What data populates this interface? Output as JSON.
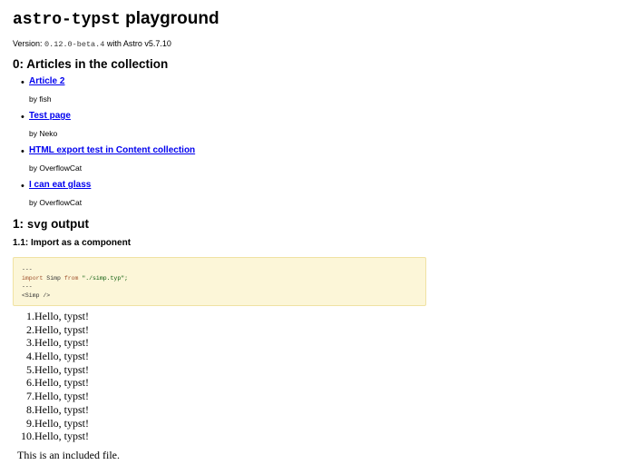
{
  "title": {
    "code": "astro-typst",
    "rest": "playground"
  },
  "version": {
    "prefix": "Version:",
    "number": "0.12.0-beta.4",
    "suffix": "with Astro v5.7.10"
  },
  "section0": {
    "heading": "0: Articles in the collection"
  },
  "articles": [
    {
      "title": "Article 2",
      "author": "by fish"
    },
    {
      "title": "Test page",
      "author": "by Neko"
    },
    {
      "title": "HTML export test in Content collection",
      "author": "by OverflowCat"
    },
    {
      "title": "I can eat glass",
      "author": "by OverflowCat"
    }
  ],
  "section1": {
    "prefix": "1:",
    "code": "svg",
    "suffix": "output"
  },
  "subsection": {
    "heading": "1.1: Import as a component"
  },
  "code": {
    "fence_open": "---",
    "import_kw": "import",
    "import_name": " Simp ",
    "from_kw": "from",
    "path": " \"./simp.typ\";",
    "fence_close": "---",
    "component": "<Simp />"
  },
  "hello_list": [
    {
      "num": "1.",
      "text": "Hello, typst!"
    },
    {
      "num": "2.",
      "text": "Hello, typst!"
    },
    {
      "num": "3.",
      "text": "Hello, typst!"
    },
    {
      "num": "4.",
      "text": "Hello, typst!"
    },
    {
      "num": "5.",
      "text": "Hello, typst!"
    },
    {
      "num": "6.",
      "text": "Hello, typst!"
    },
    {
      "num": "7.",
      "text": "Hello, typst!"
    },
    {
      "num": "8.",
      "text": "Hello, typst!"
    },
    {
      "num": "9.",
      "text": "Hello, typst!"
    },
    {
      "num": "10.",
      "text": "Hello, typst!"
    }
  ],
  "included_text": "This is an included file.",
  "colors": {
    "link": "#0000ee",
    "code_background": "#fcf6d8",
    "code_border": "#f0e2a3"
  }
}
